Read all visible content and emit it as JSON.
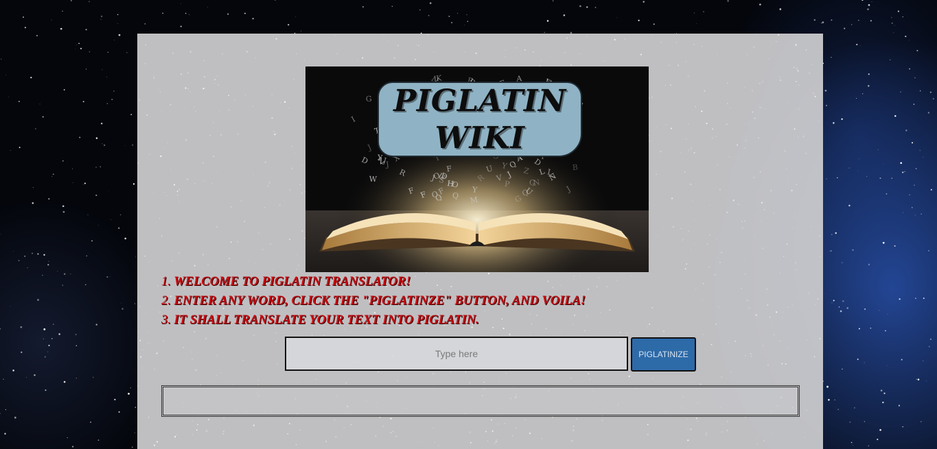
{
  "header": {
    "title_line1": "PIGLATIN",
    "title_line2": "WIKI"
  },
  "instructions": [
    {
      "num": "1.",
      "text": "WELCOME TO PIGLATIN TRANSLATOR!"
    },
    {
      "num": "2.",
      "text": "ENTER ANY WORD, CLICK THE \"PIGLATINZE\" BUTTON, AND VOILA!"
    },
    {
      "num": "3.",
      "text": "IT SHALL TRANSLATE YOUR TEXT INTO PIGLATIN."
    }
  ],
  "form": {
    "input_placeholder": "Type here",
    "input_value": "",
    "button_label": "PIGLATINIZE"
  },
  "output": {
    "text": ""
  },
  "colors": {
    "instruction_text": "#c80c12",
    "button_bg": "#2d6aa8",
    "title_box": "#8fb3c4"
  },
  "icons": {
    "hero_image": "open-book-icon"
  }
}
